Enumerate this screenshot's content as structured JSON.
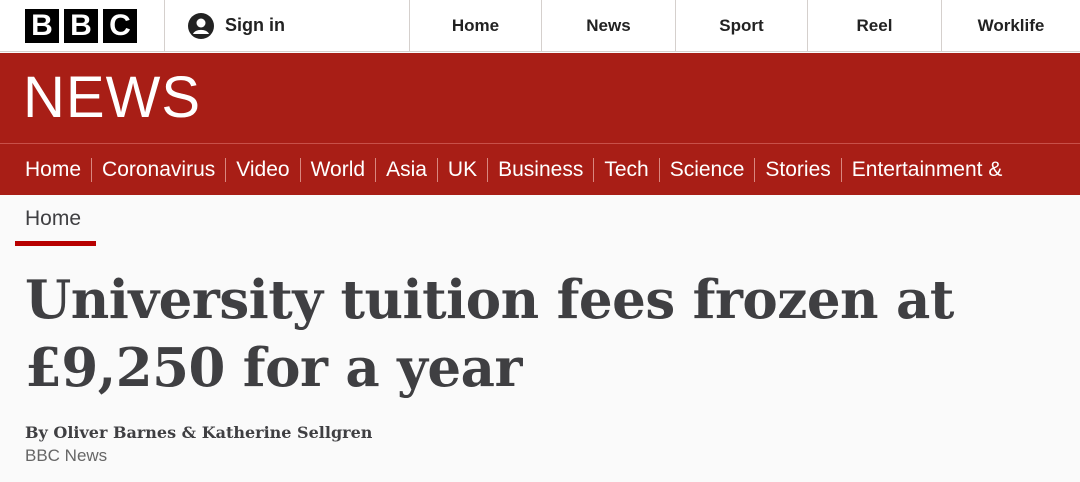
{
  "brand": {
    "letters": [
      "B",
      "B",
      "C"
    ]
  },
  "topbar": {
    "signin_label": "Sign in",
    "nav": [
      "Home",
      "News",
      "Sport",
      "Reel",
      "Worklife"
    ]
  },
  "masthead": {
    "title": "NEWS"
  },
  "section_nav": [
    "Home",
    "Coronavirus",
    "Video",
    "World",
    "Asia",
    "UK",
    "Business",
    "Tech",
    "Science",
    "Stories",
    "Entertainment &"
  ],
  "breadcrumb": {
    "label": "Home"
  },
  "article": {
    "headline": "University tuition fees frozen at £9,250 for a year",
    "byline": "By Oliver Barnes & Katherine Sellgren",
    "source": "BBC News"
  },
  "colors": {
    "brand_red": "#a81e16",
    "underline_red": "#b80000"
  }
}
